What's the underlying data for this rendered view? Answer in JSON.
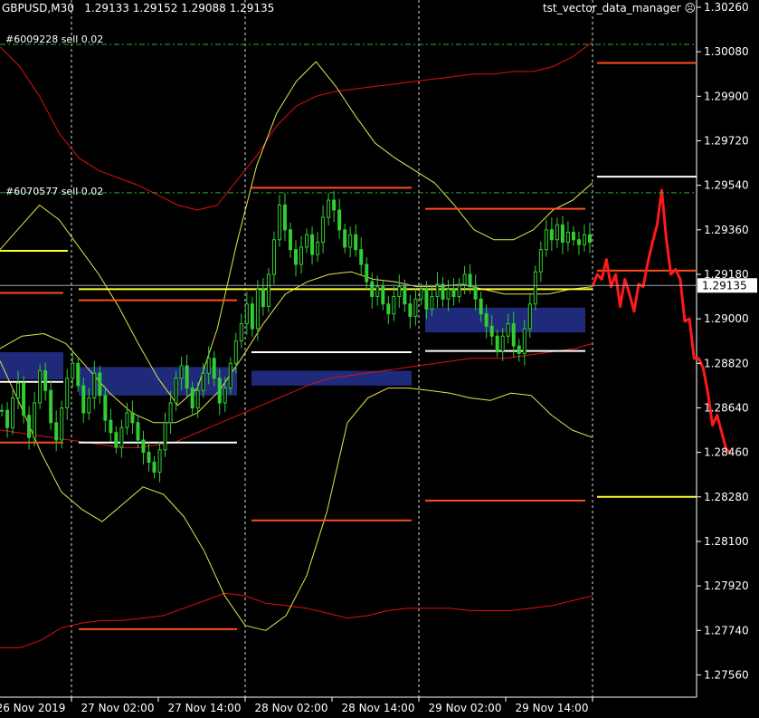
{
  "header": {
    "symbol": "GBPUSD,M30",
    "ohlc": "1.29133 1.29152 1.29088 1.29135",
    "ea_name": "tst_vector_data_manager",
    "ea_icon": "frown-icon"
  },
  "orders": [
    {
      "label": "#6009228 sell 0.02",
      "price": 1.3011
    },
    {
      "label": "#6070577 sell 0.02",
      "price": 1.2951
    }
  ],
  "colors": {
    "background": "#000000",
    "grid": "#ffffff",
    "candle": "#33cc33",
    "ma_red": "#dd1111",
    "bands_yellow": "#e6e64a",
    "level_orange": "#ff4d1a",
    "level_white": "#ffffff",
    "level_yellow": "#ffff33",
    "zone_blue": "#1f2a7a",
    "forecast": "#ff1a1a",
    "order_line": "#2fa83a",
    "bid_line": "#9aa3b2"
  },
  "chart_data": {
    "type": "candlestick",
    "symbol": "GBPUSD",
    "timeframe": "M30",
    "current_price": "1.29135",
    "ylim": [
      1.2747,
      1.3026
    ],
    "y_ticks": [
      "1.30260",
      "1.30080",
      "1.29900",
      "1.29720",
      "1.29540",
      "1.29360",
      "1.29180",
      "1.29000",
      "1.28820",
      "1.28640",
      "1.28460",
      "1.28280",
      "1.28100",
      "1.27920",
      "1.27740",
      "1.27560"
    ],
    "x_ticks": [
      "26 Nov 2019",
      "27 Nov 02:00",
      "27 Nov 14:00",
      "28 Nov 02:00",
      "28 Nov 14:00",
      "29 Nov 02:00",
      "29 Nov 14:00"
    ],
    "closes": [
      1.2863,
      1.2856,
      1.2868,
      1.2874,
      1.2861,
      1.2852,
      1.2866,
      1.2879,
      1.2871,
      1.2858,
      1.2851,
      1.2864,
      1.2876,
      1.2882,
      1.2873,
      1.2862,
      1.2868,
      1.2878,
      1.2869,
      1.2859,
      1.2854,
      1.2848,
      1.2856,
      1.2862,
      1.2858,
      1.2851,
      1.2846,
      1.2842,
      1.2838,
      1.2847,
      1.2858,
      1.2866,
      1.2876,
      1.2881,
      1.2872,
      1.2864,
      1.2871,
      1.2878,
      1.2884,
      1.2876,
      1.2866,
      1.2872,
      1.2882,
      1.2891,
      1.2898,
      1.2906,
      1.2896,
      1.2912,
      1.2905,
      1.2918,
      1.2932,
      1.2946,
      1.2936,
      1.2928,
      1.2922,
      1.2929,
      1.2934,
      1.2926,
      1.2931,
      1.2941,
      1.2948,
      1.2944,
      1.2936,
      1.2929,
      1.2934,
      1.2928,
      1.2922,
      1.2915,
      1.2909,
      1.2913,
      1.2906,
      1.2902,
      1.2909,
      1.2913,
      1.2906,
      1.2901,
      1.2908,
      1.2912,
      1.2904,
      1.2909,
      1.2914,
      1.2908,
      1.2912,
      1.2909,
      1.2914,
      1.2918,
      1.2913,
      1.2908,
      1.2902,
      1.2897,
      1.2893,
      1.2887,
      1.2893,
      1.2898,
      1.2889,
      1.2886,
      1.2896,
      1.2906,
      1.2919,
      1.2928,
      1.2936,
      1.2932,
      1.2938,
      1.2931,
      1.2935,
      1.2932,
      1.293,
      1.2934,
      1.2931
    ],
    "ma_red": [
      1.2855,
      1.2854,
      1.2853,
      1.2852,
      1.2851,
      1.285,
      1.2849,
      1.2848,
      1.2848,
      1.2849,
      1.285,
      1.2853,
      1.2856,
      1.2859,
      1.2862,
      1.2865,
      1.2868,
      1.2871,
      1.2874,
      1.2876,
      1.2877,
      1.2878,
      1.2879,
      1.288,
      1.2881,
      1.2882,
      1.2883,
      1.2884,
      1.2884,
      1.2884,
      1.2885,
      1.2886,
      1.2887,
      1.2888,
      1.289
    ],
    "ma_red_upper": [
      1.301,
      1.3002,
      1.299,
      1.2975,
      1.2965,
      1.296,
      1.2957,
      1.2954,
      1.295,
      1.2946,
      1.2944,
      1.2946,
      1.2956,
      1.2966,
      1.2978,
      1.2986,
      1.299,
      1.2992,
      1.2993,
      1.2994,
      1.2995,
      1.2996,
      1.2997,
      1.2998,
      1.2999,
      1.2999,
      1.3,
      1.3,
      1.3002,
      1.3006,
      1.3012
    ],
    "ma_red_lower": [
      1.2767,
      1.2767,
      1.277,
      1.2775,
      1.2777,
      1.2778,
      1.2778,
      1.2779,
      1.278,
      1.2783,
      1.2786,
      1.2789,
      1.2788,
      1.2785,
      1.2784,
      1.2783,
      1.2781,
      1.2779,
      1.278,
      1.2782,
      1.2783,
      1.2783,
      1.2783,
      1.2782,
      1.2782,
      1.2782,
      1.2783,
      1.2784,
      1.2786,
      1.2788
    ],
    "bands_upper": [
      1.2928,
      1.2937,
      1.2946,
      1.294,
      1.2929,
      1.2918,
      1.2905,
      1.289,
      1.2876,
      1.2865,
      1.2872,
      1.2896,
      1.2931,
      1.2962,
      1.2983,
      1.2996,
      1.3004,
      1.2994,
      1.2982,
      1.2971,
      1.2965,
      1.296,
      1.2955,
      1.2946,
      1.2936,
      1.2932,
      1.2932,
      1.2936,
      1.2944,
      1.2948,
      1.2955
    ],
    "bands_mid": [
      1.2888,
      1.2893,
      1.2894,
      1.289,
      1.288,
      1.287,
      1.2862,
      1.2858,
      1.2858,
      1.2862,
      1.2871,
      1.2884,
      1.2898,
      1.291,
      1.2915,
      1.2918,
      1.2919,
      1.2916,
      1.2915,
      1.2913,
      1.2913,
      1.2914,
      1.2912,
      1.291,
      1.291,
      1.291,
      1.2912,
      1.2913
    ],
    "bands_lower": [
      1.2883,
      1.2865,
      1.2846,
      1.283,
      1.2823,
      1.2818,
      1.2825,
      1.2832,
      1.2829,
      1.282,
      1.2806,
      1.2788,
      1.2776,
      1.2774,
      1.278,
      1.2796,
      1.2822,
      1.2858,
      1.2868,
      1.2872,
      1.2872,
      1.2871,
      1.287,
      1.2868,
      1.2867,
      1.287,
      1.2869,
      1.2861,
      1.2855,
      1.2852
    ],
    "levels": [
      {
        "color": "level_yellow",
        "price": 1.29275,
        "x": [
          0,
          75
        ]
      },
      {
        "color": "level_orange",
        "price": 1.29105,
        "x": [
          0,
          70
        ]
      },
      {
        "color": "level_white",
        "price": 1.28745,
        "x": [
          0,
          70
        ]
      },
      {
        "color": "level_orange",
        "price": 1.285,
        "x": [
          0,
          70
        ]
      },
      {
        "color": "level_orange",
        "price": 1.29075,
        "x": [
          87,
          262
        ]
      },
      {
        "color": "level_white",
        "price": 1.285,
        "x": [
          87,
          262
        ]
      },
      {
        "color": "level_orange",
        "price": 1.27745,
        "x": [
          87,
          262
        ]
      },
      {
        "color": "level_orange",
        "price": 1.2953,
        "x": [
          278,
          455
        ]
      },
      {
        "color": "level_white",
        "price": 1.28865,
        "x": [
          278,
          455
        ]
      },
      {
        "color": "level_orange",
        "price": 1.28185,
        "x": [
          278,
          455
        ]
      },
      {
        "color": "level_orange",
        "price": 1.29445,
        "x": [
          470,
          647
        ]
      },
      {
        "color": "level_white",
        "price": 1.2887,
        "x": [
          470,
          647
        ]
      },
      {
        "color": "level_orange",
        "price": 1.28265,
        "x": [
          470,
          647
        ]
      },
      {
        "color": "level_orange",
        "price": 1.30035,
        "x": [
          660,
          770
        ]
      },
      {
        "color": "level_white",
        "price": 1.29575,
        "x": [
          660,
          770
        ]
      },
      {
        "color": "level_orange",
        "price": 1.29195,
        "x": [
          660,
          770
        ]
      },
      {
        "color": "level_yellow",
        "price": 1.2828,
        "x": [
          660,
          770
        ]
      },
      {
        "color": "level_yellow",
        "price": 1.2912,
        "x": [
          87,
          655
        ]
      }
    ],
    "zones": [
      {
        "x": [
          0,
          70
        ],
        "y": [
          1.28865,
          1.28755
        ]
      },
      {
        "x": [
          87,
          262
        ],
        "y": [
          1.28805,
          1.2869
        ]
      },
      {
        "x": [
          278,
          455
        ],
        "y": [
          1.2879,
          1.2873
        ]
      },
      {
        "x": [
          470,
          647
        ],
        "y": [
          1.29045,
          1.28945
        ]
      }
    ],
    "forecast": [
      1.2913,
      1.2918,
      1.2916,
      1.2924,
      1.2913,
      1.2918,
      1.2905,
      1.2916,
      1.291,
      1.2903,
      1.2914,
      1.2913,
      1.2923,
      1.2931,
      1.2938,
      1.2952,
      1.2932,
      1.2918,
      1.292,
      1.2916,
      1.2899,
      1.29,
      1.2884,
      1.2884,
      1.288,
      1.287,
      1.2857,
      1.2861,
      1.2854,
      1.2847,
      1.2846
    ]
  }
}
